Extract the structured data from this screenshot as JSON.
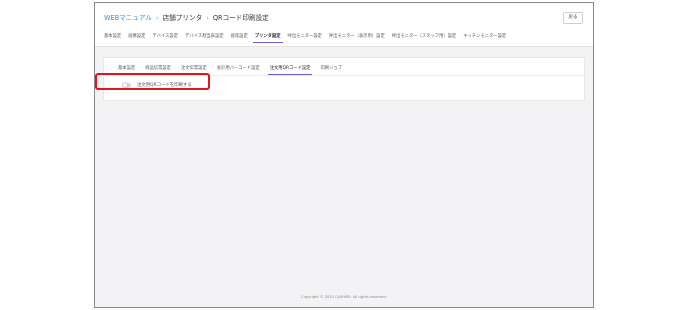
{
  "breadcrumb": {
    "root": "WEBマニュアル",
    "section": "店舗プリンタ",
    "page": "QRコード印刷設定"
  },
  "header": {
    "back_label": "戻る"
  },
  "tabs": [
    {
      "label": "基本設定",
      "active": false
    },
    {
      "label": "画像設定",
      "active": false
    },
    {
      "label": "デバイス設定",
      "active": false
    },
    {
      "label": "デバイス割当表設定",
      "active": false
    },
    {
      "label": "座席設定",
      "active": false
    },
    {
      "label": "プリンタ設定",
      "active": true
    },
    {
      "label": "呼出モニター設定",
      "active": false
    },
    {
      "label": "呼出モニター（表示用）設定",
      "active": false
    },
    {
      "label": "呼出モニター（スタッフ用）設定",
      "active": false
    },
    {
      "label": "キッチンモニター設定",
      "active": false
    }
  ],
  "subtabs": [
    {
      "label": "基本設定",
      "active": false
    },
    {
      "label": "商品伝票設定",
      "active": false
    },
    {
      "label": "注文伝票設定",
      "active": false
    },
    {
      "label": "会計用バーコード設定",
      "active": false
    },
    {
      "label": "注文用QRコード設定",
      "active": true
    },
    {
      "label": "印刷ジョブ",
      "active": false
    }
  ],
  "setting": {
    "toggle_label": "注文用QRコードを印刷する",
    "enabled": false
  },
  "footer": {
    "copyright": "Copyright © 2025 CASHIER. All rights reserved."
  },
  "colors": {
    "accent": "#6b5bd2",
    "link": "#2f8fdc",
    "highlight": "#e0141e"
  }
}
